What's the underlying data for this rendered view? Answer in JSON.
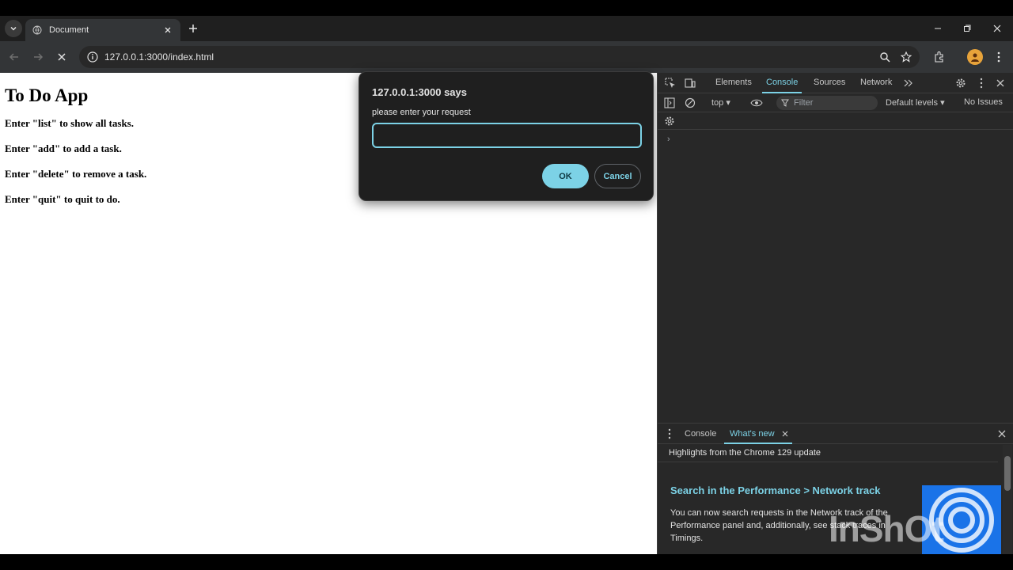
{
  "browser": {
    "tab_title": "Document",
    "url": "127.0.0.1:3000/index.html"
  },
  "page": {
    "heading": "To Do App",
    "instructions": [
      "Enter \"list\" to show all tasks.",
      "Enter \"add\" to add a task.",
      "Enter \"delete\" to remove a task.",
      "Enter \"quit\" to quit to do."
    ]
  },
  "dialog": {
    "title": "127.0.0.1:3000 says",
    "message": "please enter your request",
    "input_value": "",
    "ok_label": "OK",
    "cancel_label": "Cancel"
  },
  "devtools": {
    "tabs": [
      "Elements",
      "Console",
      "Sources",
      "Network"
    ],
    "active_tab": "Console",
    "context": "top",
    "filter_placeholder": "Filter",
    "levels": "Default levels",
    "issues": "No Issues",
    "prompt": "›",
    "drawer": {
      "tabs": [
        "Console",
        "What's new"
      ],
      "active_tab": "What's new",
      "heading": "Highlights from the Chrome 129 update",
      "item_title": "Search in the Performance > Network track",
      "item_desc": "You can now search requests in the Network track of the Performance panel and, additionally, see stack traces in Timings."
    }
  },
  "watermark": "InShOt",
  "colors": {
    "accent": "#7cd2e6",
    "chrome_dark": "#1f1f1f",
    "toolbar": "#333537",
    "devtools_bg": "#282828"
  }
}
